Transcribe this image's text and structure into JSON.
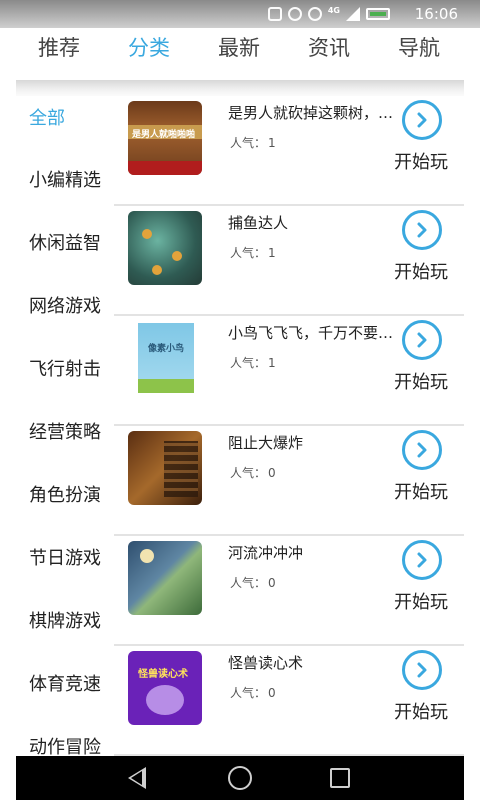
{
  "status_bar": {
    "time": "16:06",
    "network": "4G",
    "icons": [
      "nfc-icon",
      "alarm-icon",
      "wifi-icon",
      "signal-icon",
      "battery-icon"
    ]
  },
  "tabs": [
    {
      "label": "推荐",
      "active": false
    },
    {
      "label": "分类",
      "active": true
    },
    {
      "label": "最新",
      "active": false
    },
    {
      "label": "资讯",
      "active": false
    },
    {
      "label": "导航",
      "active": false
    }
  ],
  "categories": [
    {
      "label": "全部",
      "active": true
    },
    {
      "label": "小编精选",
      "active": false
    },
    {
      "label": "休闲益智",
      "active": false
    },
    {
      "label": "网络游戏",
      "active": false
    },
    {
      "label": "飞行射击",
      "active": false
    },
    {
      "label": "经营策略",
      "active": false
    },
    {
      "label": "角色扮演",
      "active": false
    },
    {
      "label": "节日游戏",
      "active": false
    },
    {
      "label": "棋牌游戏",
      "active": false
    },
    {
      "label": "体育竞速",
      "active": false
    },
    {
      "label": "动作冒险",
      "active": false
    }
  ],
  "games": [
    {
      "title": "是男人就砍掉这颗树，啪啪啪",
      "popularity_label": "人气：",
      "popularity": "1",
      "play_label": "开始玩",
      "thumb_text": "是男人就啪啪啪"
    },
    {
      "title": "捕鱼达人",
      "popularity_label": "人气：",
      "popularity": "1",
      "play_label": "开始玩"
    },
    {
      "title": "小鸟飞飞飞，千万不要落地啊",
      "popularity_label": "人气：",
      "popularity": "1",
      "play_label": "开始玩",
      "thumb_text": "像素小鸟"
    },
    {
      "title": "阻止大爆炸",
      "popularity_label": "人气：",
      "popularity": "0",
      "play_label": "开始玩"
    },
    {
      "title": "河流冲冲冲",
      "popularity_label": "人气：",
      "popularity": "0",
      "play_label": "开始玩"
    },
    {
      "title": "怪兽读心术",
      "popularity_label": "人气：",
      "popularity": "0",
      "play_label": "开始玩",
      "thumb_text": "怪兽读心术"
    }
  ],
  "colors": {
    "accent": "#3aa8df",
    "text": "#222222",
    "divider": "#e3e3e3"
  }
}
